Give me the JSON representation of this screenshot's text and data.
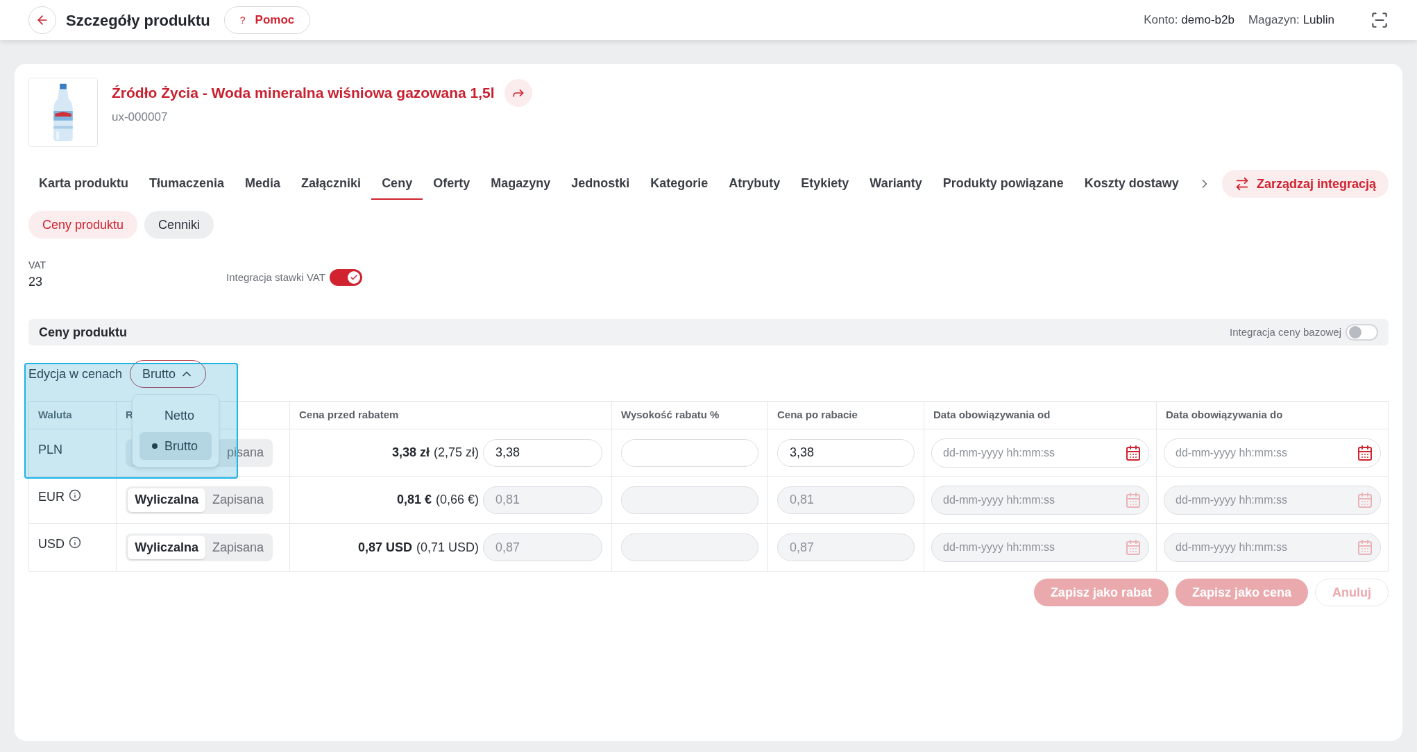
{
  "topbar": {
    "title": "Szczegóły produktu",
    "help_icon": "?",
    "help": "Pomoc",
    "account_label": "Konto:",
    "account": "demo-b2b",
    "warehouse_label": "Magazyn:",
    "warehouse": "Lublin"
  },
  "product": {
    "name": "Źródło Życia - Woda mineralna wiśniowa gazowana 1,5l",
    "sku": "ux-000007"
  },
  "tabs": [
    {
      "label": "Karta produktu",
      "selected": false
    },
    {
      "label": "Tłumaczenia",
      "selected": false
    },
    {
      "label": "Media",
      "selected": false
    },
    {
      "label": "Załączniki",
      "selected": false
    },
    {
      "label": "Ceny",
      "selected": true
    },
    {
      "label": "Oferty",
      "selected": false
    },
    {
      "label": "Magazyny",
      "selected": false
    },
    {
      "label": "Jednostki",
      "selected": false
    },
    {
      "label": "Kategorie",
      "selected": false
    },
    {
      "label": "Atrybuty",
      "selected": false
    },
    {
      "label": "Etykiety",
      "selected": false
    },
    {
      "label": "Warianty",
      "selected": false
    },
    {
      "label": "Produkty powiązane",
      "selected": false
    },
    {
      "label": "Koszty dostawy",
      "selected": false
    }
  ],
  "integration_button": "Zarządzaj integracją",
  "subtabs": [
    {
      "label": "Ceny produktu",
      "selected": true
    },
    {
      "label": "Cenniki",
      "selected": false
    }
  ],
  "vat": {
    "label": "VAT",
    "value": "23",
    "integration_label": "Integracja stawki VAT",
    "integration_on": true
  },
  "prices": {
    "title": "Ceny produktu",
    "base_integration_label": "Integracja ceny bazowej",
    "base_integration_on": false,
    "highlight": true,
    "edit_label": "Edycja w cenach",
    "edit_mode": "Brutto",
    "dropdown_open": true,
    "options": [
      {
        "label": "Netto",
        "selected": false
      },
      {
        "label": "Brutto",
        "selected": true
      }
    ],
    "columns": [
      "Waluta",
      "R",
      "Cena przed rabatem",
      "Wysokość rabatu %",
      "Cena po rabacie",
      "Data obowiązywania od",
      "Data obowiązywania do"
    ],
    "rows": [
      {
        "currency": "PLN",
        "info": false,
        "editable": true,
        "modes": [
          {
            "label": "pisana",
            "selected": false
          }
        ],
        "price": "3,38 zł",
        "price_net": "(2,75 zł)",
        "base": "3,38",
        "after": "3,38",
        "from_placeholder": "dd-mm-yyyy hh:mm:ss",
        "to_placeholder": "dd-mm-yyyy hh:mm:ss"
      },
      {
        "currency": "EUR",
        "info": true,
        "editable": false,
        "modes": [
          {
            "label": "Wyliczalna",
            "selected": true
          },
          {
            "label": "Zapisana",
            "selected": false
          }
        ],
        "price": "0,81 €",
        "price_net": "(0,66 €)",
        "base": "0,81",
        "after": "0,81",
        "from_placeholder": "dd-mm-yyyy hh:mm:ss",
        "to_placeholder": "dd-mm-yyyy hh:mm:ss"
      },
      {
        "currency": "USD",
        "info": true,
        "editable": false,
        "modes": [
          {
            "label": "Wyliczalna",
            "selected": true
          },
          {
            "label": "Zapisana",
            "selected": false
          }
        ],
        "price": "0,87 USD",
        "price_net": "(0,71 USD)",
        "base": "0,87",
        "after": "0,87",
        "from_placeholder": "dd-mm-yyyy hh:mm:ss",
        "to_placeholder": "dd-mm-yyyy hh:mm:ss"
      }
    ]
  },
  "actions": [
    {
      "label": "Zapisz jako rabat",
      "kind": "primary",
      "disabled": true
    },
    {
      "label": "Zapisz jako cena",
      "kind": "primary",
      "disabled": true
    },
    {
      "label": "Anuluj",
      "kind": "outline",
      "disabled": true
    }
  ]
}
